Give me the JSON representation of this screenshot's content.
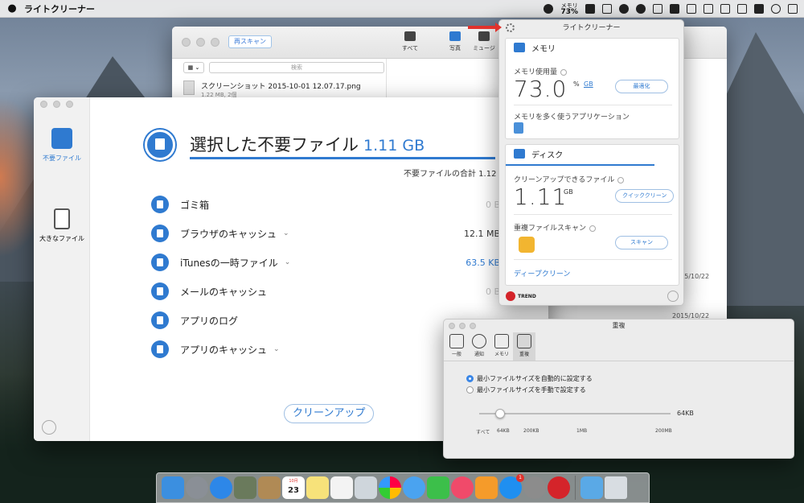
{
  "menubar": {
    "apple": "",
    "app_name": "ライトクリーナー",
    "mem_label": "メモリ",
    "mem_value": "73%"
  },
  "back_window": {
    "rescan": "再スキャン",
    "tb_all": "すべて",
    "tb_photo": "写真",
    "tb_music": "ミュージ",
    "view_toggle": "▦ ⌄",
    "search_placeholder": "検索",
    "file_name": "スクリーンショット 2015-10-01 12.07.17.png",
    "file_sub": "1.22 MB, 2個",
    "date1": "2015/10/22",
    "date2": "2015/10/22"
  },
  "main_window": {
    "sidebar": {
      "junk_label": "不要ファイル",
      "large_label": "大きなファイル"
    },
    "title": "選択した不要ファイル",
    "title_size": "1.11 GB",
    "total": "不要ファイルの合計 1.12",
    "rows": [
      {
        "label": "ゴミ箱",
        "value": "0 B",
        "chevron": ""
      },
      {
        "label": "ブラウザのキャッシュ",
        "value": "12.1 MB",
        "chevron": "⌄"
      },
      {
        "label": "iTunesの一時ファイル",
        "value": "63.5 KB",
        "chevron": "⌄"
      },
      {
        "label": "メールのキャッシュ",
        "value": "0 B",
        "chevron": ""
      },
      {
        "label": "アプリのログ",
        "value": "",
        "chevron": ""
      },
      {
        "label": "アプリのキャッシュ",
        "value": "",
        "chevron": "⌄"
      }
    ],
    "clean_button": "クリーンアップ"
  },
  "popover": {
    "title": "ライトクリーナー",
    "memory": {
      "header": "メモリ",
      "usage_label": "メモリ使用量",
      "usage_value": "73.0",
      "unit_pct": "%",
      "unit_gb": "GB",
      "optimize": "最適化",
      "apps_label": "メモリを多く使うアプリケーション"
    },
    "disk": {
      "header": "ディスク",
      "cleanable_label": "クリーンアップできるファイル",
      "cleanable_value": "1.11",
      "cleanable_unit": "GB",
      "quick_clean": "クイッククリーン",
      "dup_label": "重複ファイルスキャン",
      "scan": "スキャン",
      "deep_clean": "ディープクリーン"
    },
    "brand": "TREND"
  },
  "settings": {
    "title": "重複",
    "tabs": [
      "一般",
      "通知",
      "メモリ",
      "重複"
    ],
    "radio_auto": "最小ファイルサイズを自動的に設定する",
    "radio_manual": "最小ファイルサイズを手動で設定する",
    "slider_value": "64KB",
    "ticks": [
      "すべて",
      "64KB",
      "200KB",
      "1MB",
      "200MB"
    ]
  },
  "dock": {
    "calendar_day": "23",
    "calendar_month": "10月",
    "appstore_badge": "1"
  },
  "colors": {
    "accent": "#2f7ad0",
    "arrow": "#e0322c"
  }
}
